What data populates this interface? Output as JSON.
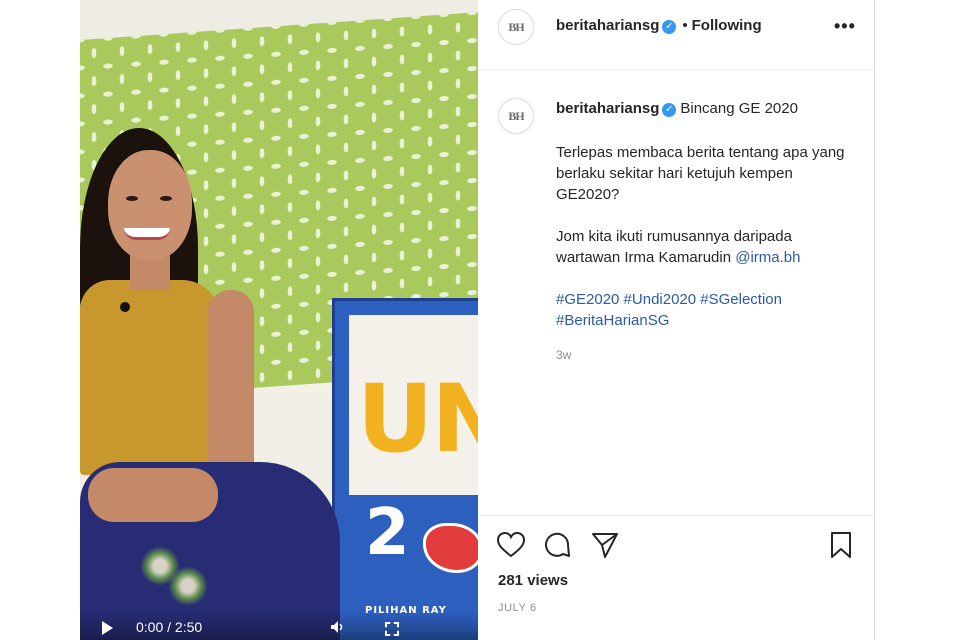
{
  "video": {
    "sign_text": "UN",
    "sign_number": "2",
    "sign_small": "PILIHAN RAY",
    "time": "0:00 / 2:50"
  },
  "post": {
    "avatar_text": "BH",
    "username": "beritahariansg",
    "verified_mark": "✓",
    "dot": "•",
    "follow_state": "Following",
    "more": "•••",
    "caption": {
      "username": "beritahariansg",
      "title": "Bincang GE 2020",
      "paragraph1": "Terlepas membaca berita tentang apa yang berlaku sekitar hari ketujuh kempen GE2020?",
      "paragraph2_text": "Jom kita ikuti rumusannya daripada wartawan Irma Kamarudin ",
      "mention": "@irma.bh",
      "hashtags_line1": "#GE2020 #Undi2020 #SGelection",
      "hashtags_line2": "#BeritaHarianSG",
      "ago": "3w"
    },
    "views": "281 views",
    "date": "JULY 6"
  },
  "icons": {
    "like": "heart-icon",
    "comment": "comment-icon",
    "share": "share-icon",
    "save": "bookmark-icon",
    "play": "play-icon",
    "volume": "volume-icon",
    "fullscreen": "fullscreen-icon"
  }
}
